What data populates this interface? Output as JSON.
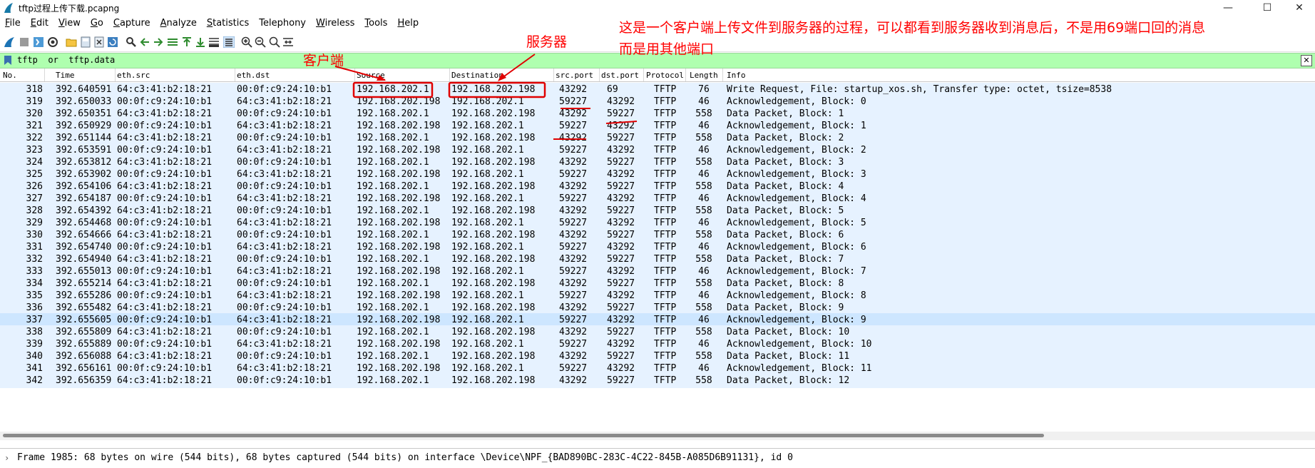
{
  "window": {
    "title": "tftp过程上传下载.pcapng",
    "controls": {
      "minimize": "—",
      "maximize": "☐",
      "close": "✕"
    }
  },
  "menu": [
    {
      "label": "File",
      "key": "F",
      "rest": "ile"
    },
    {
      "label": "Edit",
      "key": "E",
      "rest": "dit"
    },
    {
      "label": "View",
      "key": "V",
      "rest": "iew"
    },
    {
      "label": "Go",
      "key": "G",
      "rest": "o"
    },
    {
      "label": "Capture",
      "key": "C",
      "rest": "apture"
    },
    {
      "label": "Analyze",
      "key": "A",
      "rest": "nalyze"
    },
    {
      "label": "Statistics",
      "key": "S",
      "rest": "tatistics"
    },
    {
      "label": "Telephony",
      "key": "",
      "rest": "Telephony"
    },
    {
      "label": "Wireless",
      "key": "W",
      "rest": "ireless"
    },
    {
      "label": "Tools",
      "key": "T",
      "rest": "ools"
    },
    {
      "label": "Help",
      "key": "H",
      "rest": "elp"
    }
  ],
  "filter": {
    "text": "tftp  or  tftp.data"
  },
  "columns": {
    "no": "No.",
    "time": "Time",
    "eth_src": "eth.src",
    "eth_dst": "eth.dst",
    "source": "Source",
    "destination": "Destination",
    "src_port": "src.port",
    "dst_port": "dst.port",
    "protocol": "Protocol",
    "length": "Length",
    "info": "Info"
  },
  "packets": [
    [
      "318",
      "392.640591",
      "64:c3:41:b2:18:21",
      "00:0f:c9:24:10:b1",
      "192.168.202.1",
      "192.168.202.198",
      "43292",
      "69",
      "TFTP",
      "76",
      "Write Request, File: startup_xos.sh, Transfer type: octet, tsize=8538"
    ],
    [
      "319",
      "392.650033",
      "00:0f:c9:24:10:b1",
      "64:c3:41:b2:18:21",
      "192.168.202.198",
      "192.168.202.1",
      "59227",
      "43292",
      "TFTP",
      "46",
      "Acknowledgement, Block: 0"
    ],
    [
      "320",
      "392.650351",
      "64:c3:41:b2:18:21",
      "00:0f:c9:24:10:b1",
      "192.168.202.1",
      "192.168.202.198",
      "43292",
      "59227",
      "TFTP",
      "558",
      "Data Packet, Block: 1"
    ],
    [
      "321",
      "392.650929",
      "00:0f:c9:24:10:b1",
      "64:c3:41:b2:18:21",
      "192.168.202.198",
      "192.168.202.1",
      "59227",
      "43292",
      "TFTP",
      "46",
      "Acknowledgement, Block: 1"
    ],
    [
      "322",
      "392.651144",
      "64:c3:41:b2:18:21",
      "00:0f:c9:24:10:b1",
      "192.168.202.1",
      "192.168.202.198",
      "43292",
      "59227",
      "TFTP",
      "558",
      "Data Packet, Block: 2"
    ],
    [
      "323",
      "392.653591",
      "00:0f:c9:24:10:b1",
      "64:c3:41:b2:18:21",
      "192.168.202.198",
      "192.168.202.1",
      "59227",
      "43292",
      "TFTP",
      "46",
      "Acknowledgement, Block: 2"
    ],
    [
      "324",
      "392.653812",
      "64:c3:41:b2:18:21",
      "00:0f:c9:24:10:b1",
      "192.168.202.1",
      "192.168.202.198",
      "43292",
      "59227",
      "TFTP",
      "558",
      "Data Packet, Block: 3"
    ],
    [
      "325",
      "392.653902",
      "00:0f:c9:24:10:b1",
      "64:c3:41:b2:18:21",
      "192.168.202.198",
      "192.168.202.1",
      "59227",
      "43292",
      "TFTP",
      "46",
      "Acknowledgement, Block: 3"
    ],
    [
      "326",
      "392.654106",
      "64:c3:41:b2:18:21",
      "00:0f:c9:24:10:b1",
      "192.168.202.1",
      "192.168.202.198",
      "43292",
      "59227",
      "TFTP",
      "558",
      "Data Packet, Block: 4"
    ],
    [
      "327",
      "392.654187",
      "00:0f:c9:24:10:b1",
      "64:c3:41:b2:18:21",
      "192.168.202.198",
      "192.168.202.1",
      "59227",
      "43292",
      "TFTP",
      "46",
      "Acknowledgement, Block: 4"
    ],
    [
      "328",
      "392.654392",
      "64:c3:41:b2:18:21",
      "00:0f:c9:24:10:b1",
      "192.168.202.1",
      "192.168.202.198",
      "43292",
      "59227",
      "TFTP",
      "558",
      "Data Packet, Block: 5"
    ],
    [
      "329",
      "392.654468",
      "00:0f:c9:24:10:b1",
      "64:c3:41:b2:18:21",
      "192.168.202.198",
      "192.168.202.1",
      "59227",
      "43292",
      "TFTP",
      "46",
      "Acknowledgement, Block: 5"
    ],
    [
      "330",
      "392.654666",
      "64:c3:41:b2:18:21",
      "00:0f:c9:24:10:b1",
      "192.168.202.1",
      "192.168.202.198",
      "43292",
      "59227",
      "TFTP",
      "558",
      "Data Packet, Block: 6"
    ],
    [
      "331",
      "392.654740",
      "00:0f:c9:24:10:b1",
      "64:c3:41:b2:18:21",
      "192.168.202.198",
      "192.168.202.1",
      "59227",
      "43292",
      "TFTP",
      "46",
      "Acknowledgement, Block: 6"
    ],
    [
      "332",
      "392.654940",
      "64:c3:41:b2:18:21",
      "00:0f:c9:24:10:b1",
      "192.168.202.1",
      "192.168.202.198",
      "43292",
      "59227",
      "TFTP",
      "558",
      "Data Packet, Block: 7"
    ],
    [
      "333",
      "392.655013",
      "00:0f:c9:24:10:b1",
      "64:c3:41:b2:18:21",
      "192.168.202.198",
      "192.168.202.1",
      "59227",
      "43292",
      "TFTP",
      "46",
      "Acknowledgement, Block: 7"
    ],
    [
      "334",
      "392.655214",
      "64:c3:41:b2:18:21",
      "00:0f:c9:24:10:b1",
      "192.168.202.1",
      "192.168.202.198",
      "43292",
      "59227",
      "TFTP",
      "558",
      "Data Packet, Block: 8"
    ],
    [
      "335",
      "392.655286",
      "00:0f:c9:24:10:b1",
      "64:c3:41:b2:18:21",
      "192.168.202.198",
      "192.168.202.1",
      "59227",
      "43292",
      "TFTP",
      "46",
      "Acknowledgement, Block: 8"
    ],
    [
      "336",
      "392.655482",
      "64:c3:41:b2:18:21",
      "00:0f:c9:24:10:b1",
      "192.168.202.1",
      "192.168.202.198",
      "43292",
      "59227",
      "TFTP",
      "558",
      "Data Packet, Block: 9"
    ],
    [
      "337",
      "392.655605",
      "00:0f:c9:24:10:b1",
      "64:c3:41:b2:18:21",
      "192.168.202.198",
      "192.168.202.1",
      "59227",
      "43292",
      "TFTP",
      "46",
      "Acknowledgement, Block: 9"
    ],
    [
      "338",
      "392.655809",
      "64:c3:41:b2:18:21",
      "00:0f:c9:24:10:b1",
      "192.168.202.1",
      "192.168.202.198",
      "43292",
      "59227",
      "TFTP",
      "558",
      "Data Packet, Block: 10"
    ],
    [
      "339",
      "392.655889",
      "00:0f:c9:24:10:b1",
      "64:c3:41:b2:18:21",
      "192.168.202.198",
      "192.168.202.1",
      "59227",
      "43292",
      "TFTP",
      "46",
      "Acknowledgement, Block: 10"
    ],
    [
      "340",
      "392.656088",
      "64:c3:41:b2:18:21",
      "00:0f:c9:24:10:b1",
      "192.168.202.1",
      "192.168.202.198",
      "43292",
      "59227",
      "TFTP",
      "558",
      "Data Packet, Block: 11"
    ],
    [
      "341",
      "392.656161",
      "00:0f:c9:24:10:b1",
      "64:c3:41:b2:18:21",
      "192.168.202.198",
      "192.168.202.1",
      "59227",
      "43292",
      "TFTP",
      "46",
      "Acknowledgement, Block: 11"
    ],
    [
      "342",
      "392.656359",
      "64:c3:41:b2:18:21",
      "00:0f:c9:24:10:b1",
      "192.168.202.1",
      "192.168.202.198",
      "43292",
      "59227",
      "TFTP",
      "558",
      "Data Packet, Block: 12"
    ]
  ],
  "selected_packet": "337",
  "details": {
    "frame": "Frame 1985: 68 bytes on wire (544 bits), 68 bytes captured (544 bits) on interface \\Device\\NPF_{BAD890BC-283C-4C22-845B-A085D6B91131}, id 0"
  },
  "annotations": {
    "client": "客户端",
    "server": "服务器",
    "note_line1": "这是一个客户端上传文件到服务器的过程，可以都看到服务器收到消息后，不是用69端口回的消息",
    "note_line2": "而是用其他端口"
  },
  "colors": {
    "annotation": "#ff0000",
    "filter_bg": "#afffaf",
    "row_bg": "#e6f2ff",
    "row_selected": "#cde6ff"
  },
  "icons": [
    "wireshark-fin-icon",
    "start-capture-icon",
    "stop-capture-icon",
    "restart-capture-icon",
    "capture-options-icon",
    "open-file-icon",
    "save-file-icon",
    "close-file-icon",
    "reload-file-icon",
    "find-packet-icon",
    "go-back-icon",
    "go-forward-icon",
    "go-to-packet-icon",
    "go-first-icon",
    "go-last-icon",
    "auto-scroll-icon",
    "colorize-icon",
    "zoom-in-icon",
    "zoom-out-icon",
    "normal-size-icon",
    "resize-columns-icon",
    "bookmark-icon",
    "clear-filter-icon"
  ]
}
